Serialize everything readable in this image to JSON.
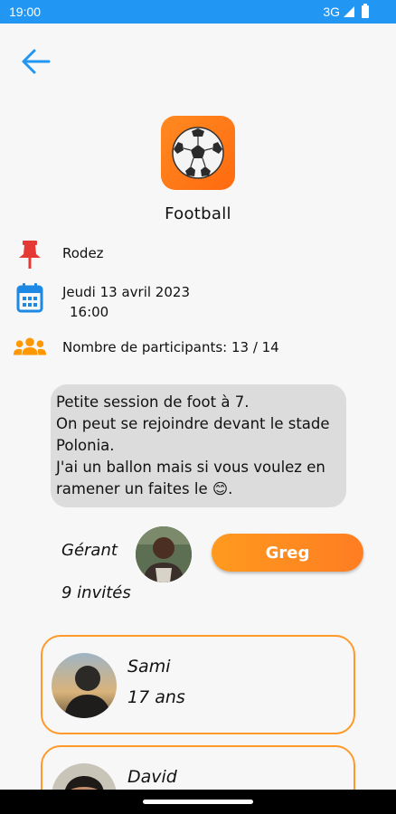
{
  "status_bar": {
    "time": "19:00",
    "network": "3G"
  },
  "event": {
    "sport": "Football",
    "location": "Rodez",
    "date": "Jeudi 13 avril 2023",
    "time": "16:00",
    "participants_text": "Nombre de participants: 13 / 14",
    "description": "Petite session de foot à 7.\nOn peut se rejoindre devant le stade Polonia.\nJ'ai un ballon mais si vous voulez en ramener un faites le 😊."
  },
  "manager": {
    "label": "Gérant",
    "name": "Greg"
  },
  "guests": {
    "text": "9 invités"
  },
  "participants": [
    {
      "name": "Sami",
      "age": "17 ans"
    },
    {
      "name": "David",
      "age": ""
    }
  ],
  "colors": {
    "accent": "#ff8a1f",
    "status_bar": "#2196f3",
    "back_arrow": "#2196f3",
    "pin": "#e53935",
    "calendar": "#1e88e5",
    "people": "#ff9800"
  }
}
